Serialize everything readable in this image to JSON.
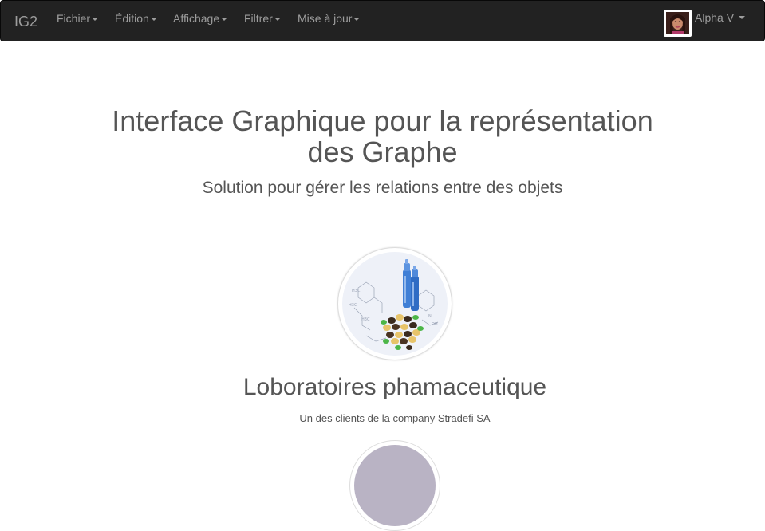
{
  "navbar": {
    "brand": "IG2",
    "menus": [
      "Fichier",
      "Édition",
      "Affichage",
      "Filtrer",
      "Mise à jour"
    ],
    "user_name": "Alpha V"
  },
  "hero": {
    "title_line1": "Interface Graphique pour la représentation",
    "title_line2": "des Graphe",
    "subtitle": "Solution pour gérer les relations entre des objets"
  },
  "card": {
    "title": "Loboratoires phamaceutique",
    "text": "Un des clients de la company Stradefi SA"
  },
  "colors": {
    "navbar_bg": "#222222",
    "navbar_text": "#9d9d9d",
    "body_text": "#555555"
  }
}
